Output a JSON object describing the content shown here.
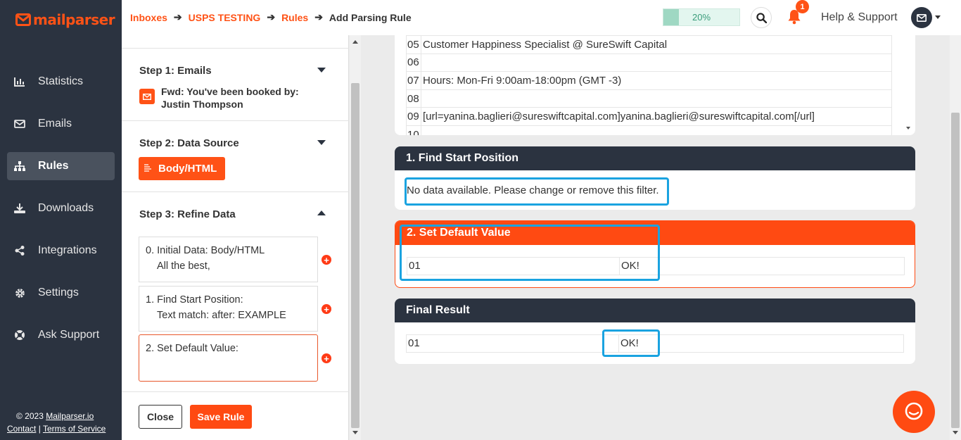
{
  "brand": {
    "logo_text": "mailparser"
  },
  "sidebar": {
    "items": [
      {
        "label": "Statistics",
        "icon": "bar-chart-icon"
      },
      {
        "label": "Emails",
        "icon": "envelope-icon"
      },
      {
        "label": "Rules",
        "icon": "sitemap-icon",
        "active": true
      },
      {
        "label": "Downloads",
        "icon": "download-icon"
      },
      {
        "label": "Integrations",
        "icon": "share-icon"
      },
      {
        "label": "Settings",
        "icon": "gear-icon"
      },
      {
        "label": "Ask Support",
        "icon": "help-circle-icon"
      }
    ],
    "footer": {
      "copyright": "© 2023 ",
      "company_link": "Mailparser.io",
      "contact": "Contact",
      "separator": " | ",
      "terms": "Terms of Service"
    }
  },
  "breadcrumb": [
    {
      "label": "Inboxes"
    },
    {
      "label": "USPS TESTING"
    },
    {
      "label": "Rules"
    },
    {
      "label": "Add Parsing Rule"
    }
  ],
  "topbar": {
    "progress_label": "20%",
    "progress_value": 0.2,
    "notification_count": "1",
    "help_label": "Help & Support"
  },
  "steps": {
    "step1": {
      "title": "Step 1: Emails",
      "email_subject": "Fwd: You've been booked by: Justin Thompson"
    },
    "step2": {
      "title": "Step 2: Data Source",
      "source_label": "Body/HTML"
    },
    "step3": {
      "title": "Step 3: Refine Data",
      "filters": [
        {
          "line1": "0. Initial Data: Body/HTML",
          "line2": "All the best,"
        },
        {
          "line1": "1. Find Start Position:",
          "line2": "Text match: after: EXAMPLE"
        },
        {
          "line1": "2. Set Default Value:",
          "line2": ""
        }
      ]
    }
  },
  "footer_buttons": {
    "close": "Close",
    "save": "Save Rule"
  },
  "preview_rows": [
    {
      "num": "05",
      "text": "Customer Happiness Specialist @ SureSwift Capital"
    },
    {
      "num": "06",
      "text": ""
    },
    {
      "num": "07",
      "text": "Hours: Mon-Fri 9:00am-18:00pm (GMT -3)"
    },
    {
      "num": "08",
      "text": ""
    },
    {
      "num": "09",
      "text": "[url=yanina.baglieri@sureswiftcapital.com]yanina.baglieri@sureswiftcapital.com[/url]"
    },
    {
      "num": "10",
      "text": ""
    }
  ],
  "cards": {
    "find_start": {
      "title": "1. Find Start Position",
      "message": "No data available. Please change or remove this filter."
    },
    "set_default": {
      "title": "2. Set Default Value",
      "col1": "01",
      "col2": "OK!"
    },
    "final": {
      "title": "Final Result",
      "col1": "01",
      "col2": "OK!"
    }
  },
  "colors": {
    "accent": "#ff5216",
    "sidebar_bg": "#2b3340",
    "highlight": "#1aa3e0"
  }
}
